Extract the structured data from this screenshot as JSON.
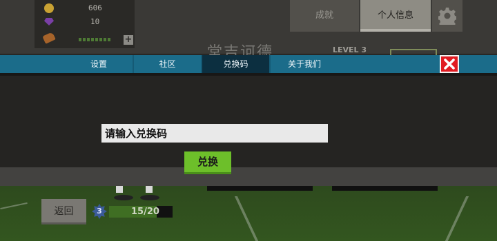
{
  "hud": {
    "coins": "606",
    "gems": "10",
    "stamina_fraction": 0.85
  },
  "top_nav": {
    "achievements_label": "成就",
    "personal_info_label": "个人信息"
  },
  "background": {
    "player_name_partial": "堂吉诃德",
    "level_text": "LEVEL 3"
  },
  "modal": {
    "tabs": [
      {
        "label": "设置"
      },
      {
        "label": "社区"
      },
      {
        "label": "兑换码"
      },
      {
        "label": "关于我们"
      }
    ],
    "active_tab": "兑换码",
    "code_input": {
      "placeholder": "请输入兑换码",
      "value": ""
    },
    "redeem_label": "兑换"
  },
  "bottom": {
    "back_label": "返回",
    "player_level": "3",
    "xp_text": "15/20",
    "xp_fraction": 0.75
  },
  "colors": {
    "tabbar": "#1b6c8a",
    "active_tab": "#0c2f40",
    "close": "#e11b22",
    "redeem": "#6dbf2a"
  }
}
